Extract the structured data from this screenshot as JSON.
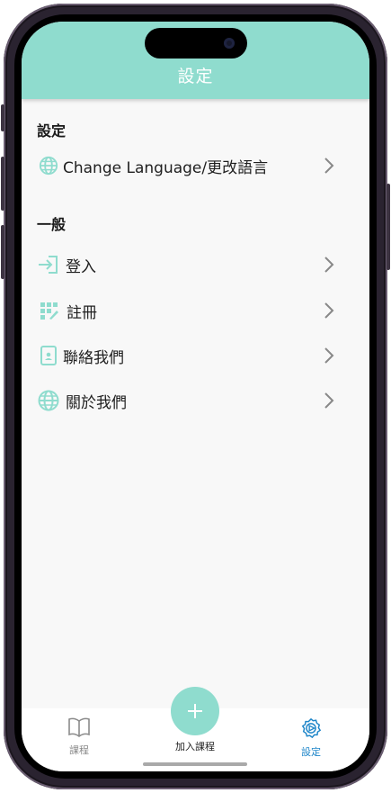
{
  "header": {
    "title": "設定"
  },
  "sections": {
    "settings": {
      "title": "設定",
      "items": [
        {
          "label": "Change Language/更改語言",
          "icon": "globe-icon"
        }
      ]
    },
    "general": {
      "title": "一般",
      "items": [
        {
          "label": "登入",
          "icon": "login-icon"
        },
        {
          "label": "註冊",
          "icon": "register-icon"
        },
        {
          "label": "聯絡我們",
          "icon": "contact-icon"
        },
        {
          "label": "關於我們",
          "icon": "globe-icon"
        }
      ]
    }
  },
  "tabbar": {
    "courses": {
      "label": "課程",
      "icon": "book-icon"
    },
    "add_course": {
      "label": "加入課程",
      "icon": "plus-icon"
    },
    "settings": {
      "label": "設定",
      "icon": "settings-icon",
      "active": true
    }
  },
  "colors": {
    "accent": "#8fdcce",
    "active_tab": "#1f86c9",
    "inactive_tab": "#888888"
  }
}
